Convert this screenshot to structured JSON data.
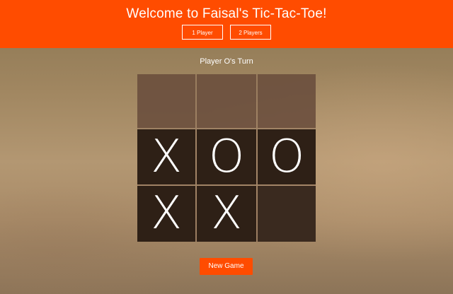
{
  "header": {
    "title": "Welcome to Faisal's Tic-Tac-Toe!",
    "one_player_label": "1 Player",
    "two_players_label": "2 Players"
  },
  "status": {
    "turn_text": "Player O's Turn"
  },
  "board": {
    "cells": [
      "",
      "",
      "",
      "X",
      "O",
      "O",
      "X",
      "X",
      ""
    ]
  },
  "controls": {
    "new_game_label": "New Game"
  },
  "colors": {
    "accent": "#ff4c00",
    "text": "#ffffff",
    "cell_filled": "#2e2016"
  }
}
